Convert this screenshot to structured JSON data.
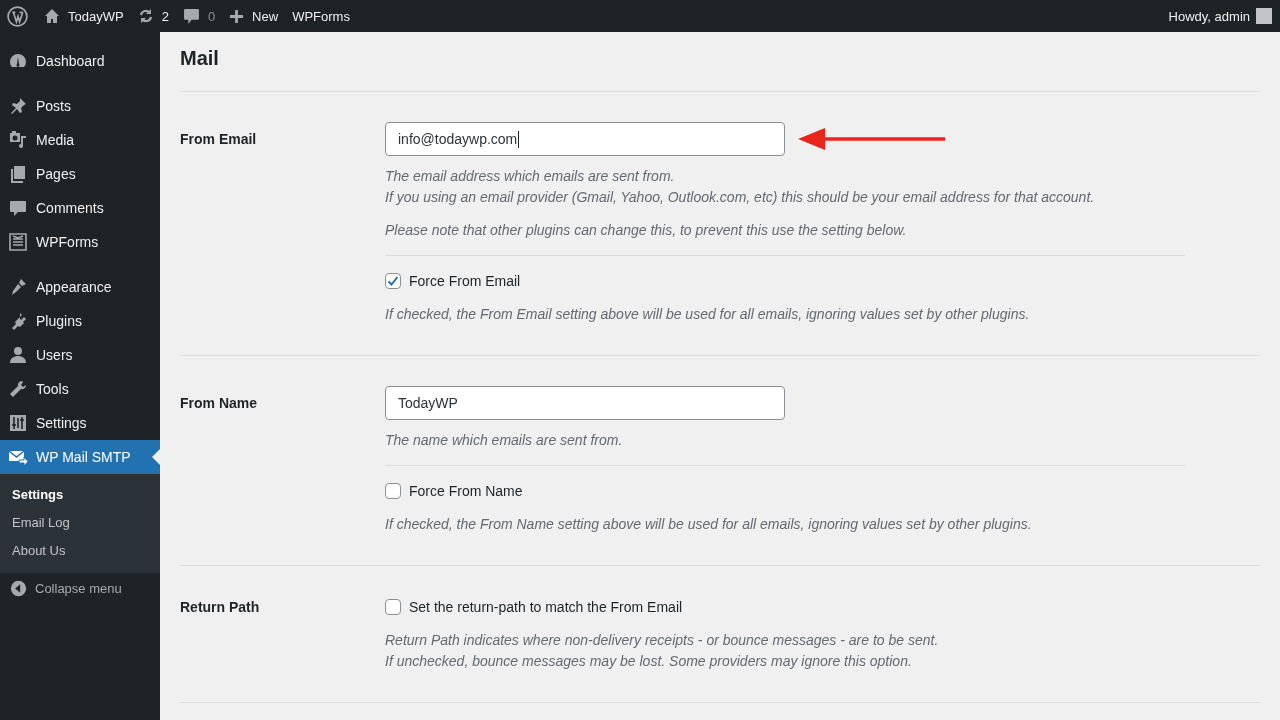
{
  "admin_bar": {
    "site": "TodayWP",
    "updates": "2",
    "comments": "0",
    "new": "New",
    "wpforms": "WPForms",
    "greeting": "Howdy, admin"
  },
  "sidebar": {
    "groups": [
      [
        {
          "label": "Dashboard",
          "selected": false
        }
      ],
      [
        {
          "label": "Posts",
          "selected": false
        },
        {
          "label": "Media",
          "selected": false
        },
        {
          "label": "Pages",
          "selected": false
        },
        {
          "label": "Comments",
          "selected": false
        },
        {
          "label": "WPForms",
          "selected": false
        }
      ],
      [
        {
          "label": "Appearance",
          "selected": false
        },
        {
          "label": "Plugins",
          "selected": false
        },
        {
          "label": "Users",
          "selected": false
        },
        {
          "label": "Tools",
          "selected": false
        },
        {
          "label": "Settings",
          "selected": false
        },
        {
          "label": "WP Mail SMTP",
          "selected": true
        }
      ]
    ],
    "submenu": [
      {
        "label": "Settings",
        "selected": true
      },
      {
        "label": "Email Log",
        "selected": false
      },
      {
        "label": "About Us",
        "selected": false
      }
    ],
    "collapse": "Collapse menu"
  },
  "page": {
    "title": "Mail",
    "sections": [
      {
        "label": "From Email",
        "groups": [
          [
            {
              "kind": "input",
              "value": "info@todaywp.com",
              "focused": true,
              "annotated": true
            },
            {
              "kind": "help",
              "lines": [
                "The email address which emails are sent from.",
                "If you using an email provider (Gmail, Yahoo, Outlook.com, etc) this should be your email address for that account."
              ]
            },
            {
              "kind": "help",
              "lines": [
                "Please note that other plugins can change this, to prevent this use the setting below."
              ]
            }
          ],
          [
            {
              "kind": "checkbox",
              "label": "Force From Email",
              "checked": true
            },
            {
              "kind": "help",
              "lines": [
                "If checked, the From Email setting above will be used for all emails, ignoring values set by other plugins."
              ]
            }
          ]
        ]
      },
      {
        "label": "From Name",
        "groups": [
          [
            {
              "kind": "input",
              "value": "TodayWP",
              "focused": false,
              "annotated": false
            },
            {
              "kind": "help",
              "lines": [
                "The name which emails are sent from."
              ]
            }
          ],
          [
            {
              "kind": "checkbox",
              "label": "Force From Name",
              "checked": false
            },
            {
              "kind": "help",
              "lines": [
                "If checked, the From Name setting above will be used for all emails, ignoring values set by other plugins."
              ]
            }
          ]
        ]
      },
      {
        "label": "Return Path",
        "groups": [
          [
            {
              "kind": "checkbox",
              "label": "Set the return-path to match the From Email",
              "checked": false
            },
            {
              "kind": "help",
              "lines": [
                "Return Path indicates where non-delivery receipts - or bounce messages - are to be sent.",
                "If unchecked, bounce messages may be lost. Some providers may ignore this option."
              ]
            }
          ]
        ]
      }
    ]
  }
}
